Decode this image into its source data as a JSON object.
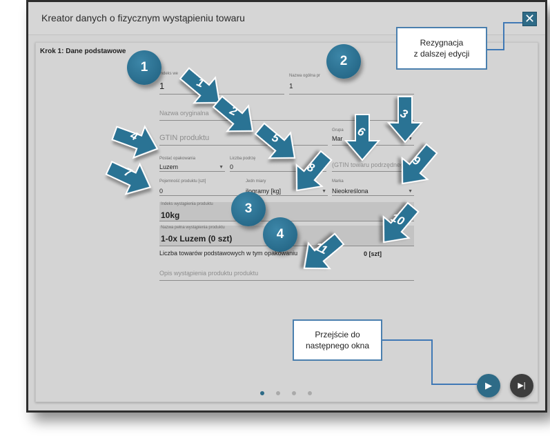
{
  "dialog": {
    "title": "Kreator danych o fizycznym wystąpieniu towaru",
    "close_glyph": "✕",
    "step_title": "Krok 1: Dane podstawowe"
  },
  "form": {
    "index": {
      "label": "Indeks we",
      "value": "1"
    },
    "general_name": {
      "label": "Nazwa ogólna pr",
      "value": "1"
    },
    "original_name": {
      "placeholder": "Nazwa oryginalna"
    },
    "gtin": {
      "placeholder": "GTIN produktu"
    },
    "group": {
      "label": "Grupa",
      "value": "Mar"
    },
    "packaging": {
      "label": "Postać opakowania",
      "value": "Luzem"
    },
    "sub_count": {
      "label": "Liczba podrzę",
      "value": "0"
    },
    "gtin_sub": {
      "placeholder": "(GTIN towaru podrzędneg"
    },
    "capacity": {
      "label": "Pojemność produktu [szt]",
      "value": "0"
    },
    "unit": {
      "label": "Jedn miary",
      "value": "ilogramy [kg]"
    },
    "brand": {
      "label": "Marka",
      "value": "Nieokreślona"
    },
    "occ_index": {
      "label": "Indeks wystąpienia produktu",
      "value": "10kg"
    },
    "full_name": {
      "label": "Nazwa pełna wystąpienia produktu",
      "value": "1-0x Luzem (0 szt)"
    },
    "base_count": {
      "label": "Liczba towarów podstawowych w tym opakowaniu",
      "value": "0 [szt]"
    },
    "description": {
      "placeholder": "Opis wystąpienia produktu produktu"
    }
  },
  "pager": {
    "count": 4,
    "active": 0
  },
  "buttons": {
    "next_glyph": "▶",
    "last_glyph": "▶|"
  },
  "callouts": {
    "cancel": [
      "Rezygnacja",
      "z dalszej edycji"
    ],
    "next": [
      "Przejście do",
      "następnego okna"
    ]
  },
  "circle_labels": [
    "1",
    "2",
    "3",
    "4"
  ],
  "arrow_labels": [
    "1",
    "2",
    "3",
    "4",
    "5",
    "6",
    "7",
    "8",
    "9",
    "10",
    "11"
  ],
  "colors": {
    "accent": "#2e6b87",
    "circle": "#2a6f8f",
    "arrow": "#2b7394",
    "callout_border": "#4a7fae",
    "connector": "#3f78b5"
  }
}
